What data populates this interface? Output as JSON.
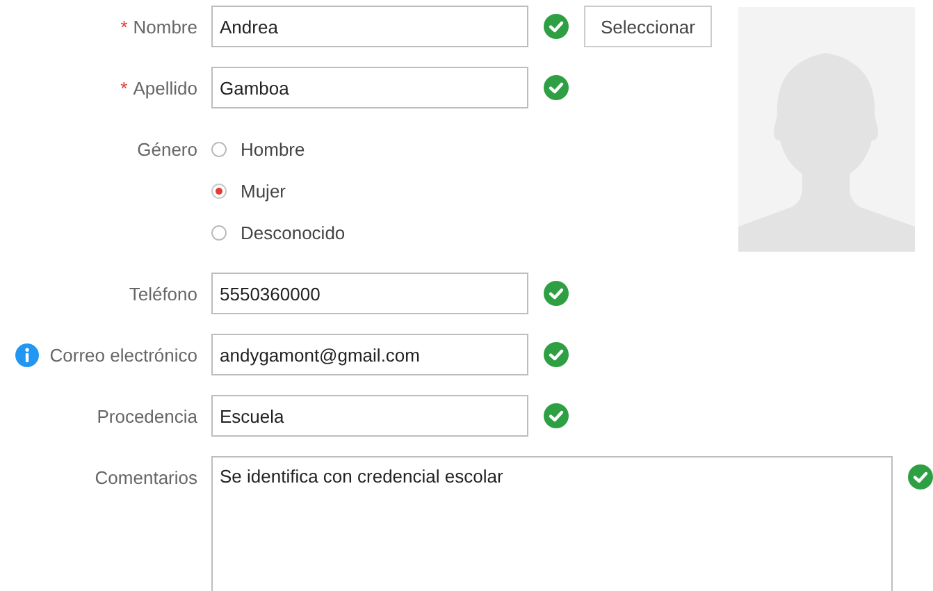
{
  "fields": [
    {
      "kind": "text",
      "label": "Nombre",
      "marker": "*",
      "value": "Andrea",
      "valid": true,
      "button": "Seleccionar"
    },
    {
      "kind": "text",
      "label": "Apellido",
      "marker": "*",
      "value": "Gamboa",
      "valid": true
    },
    {
      "kind": "radio",
      "label": "Género",
      "options": [
        {
          "label": "Hombre",
          "selected": false
        },
        {
          "label": "Mujer",
          "selected": true
        },
        {
          "label": "Desconocido",
          "selected": false
        }
      ]
    },
    {
      "kind": "text",
      "label": "Teléfono",
      "value": "5550360000",
      "valid": true
    },
    {
      "kind": "text",
      "label": "Correo electrónico",
      "info": true,
      "value": "andygamont@gmail.com",
      "valid": true
    },
    {
      "kind": "text",
      "label": "Procedencia",
      "value": "Escuela",
      "valid": true
    },
    {
      "kind": "textarea",
      "label": "Comentarios",
      "value": "Se identifica con credencial escolar",
      "valid": true
    }
  ]
}
